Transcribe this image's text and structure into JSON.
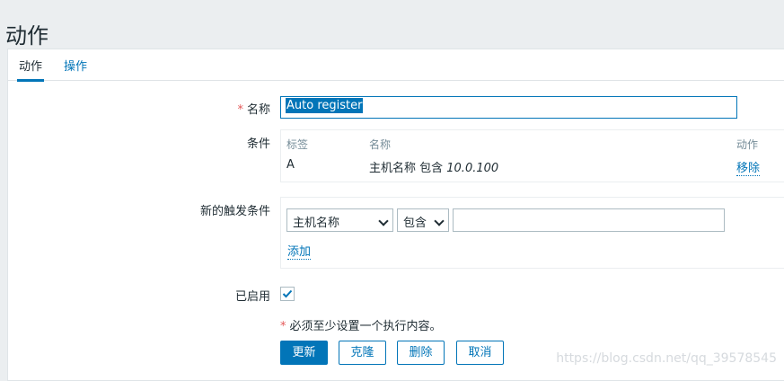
{
  "page": {
    "title": "动作"
  },
  "tabs": [
    {
      "label": "动作",
      "active": true
    },
    {
      "label": "操作",
      "active": false
    }
  ],
  "form": {
    "name_label": "名称",
    "name_required_mark": "*",
    "name_value": "Auto register",
    "conditions_label": "条件",
    "conditions_table": {
      "headers": {
        "tag": "标签",
        "name": "名称",
        "action": "动作"
      },
      "rows": [
        {
          "tag": "A",
          "name_prefix": "主机名称 包含 ",
          "name_value": "10.0.100",
          "action": "移除"
        }
      ]
    },
    "new_condition_label": "新的触发条件",
    "new_condition": {
      "type_selected": "主机名称",
      "operator_selected": "包含",
      "value": "",
      "add_link": "添加"
    },
    "enabled_label": "已启用",
    "enabled": true,
    "required_note_mark": "*",
    "required_note": "必须至少设置一个执行内容。"
  },
  "buttons": {
    "update": "更新",
    "clone": "克隆",
    "delete": "删除",
    "cancel": "取消"
  },
  "watermark": "https://blog.csdn.net/qq_39578545",
  "colors": {
    "accent": "#0275b8",
    "required": "#e45959",
    "background": "#ebeef0"
  }
}
